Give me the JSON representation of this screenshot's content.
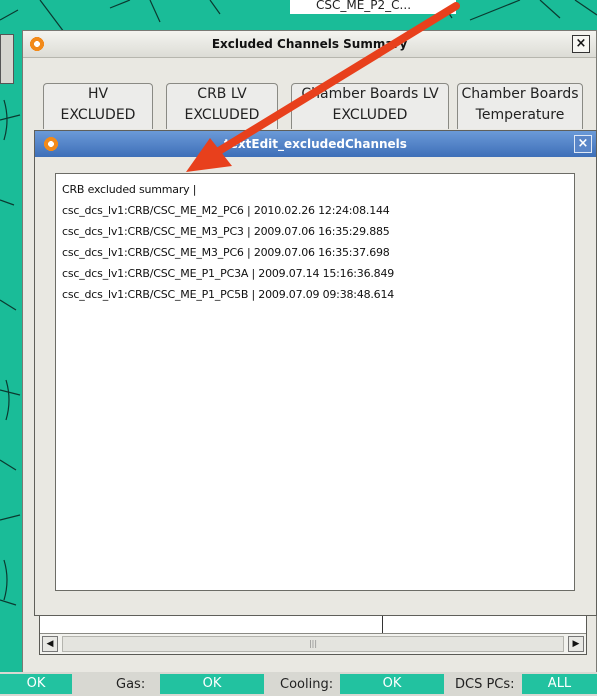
{
  "background": {
    "title": "CSC_ME_P2_C..."
  },
  "outer_window": {
    "title": "Excluded Channels Summary",
    "tabs": [
      {
        "line1": "HV",
        "line2": "EXCLUDED"
      },
      {
        "line1": "CRB LV",
        "line2": "EXCLUDED"
      },
      {
        "line1": "Chamber Boards LV",
        "line2": "EXCLUDED"
      },
      {
        "line1": "Chamber Boards",
        "line2": "Temperature"
      }
    ]
  },
  "inner_window": {
    "title": "textEdit_excludedChannels",
    "lines": [
      "CRB excluded summary |",
      "csc_dcs_lv1:CRB/CSC_ME_M2_PC6 | 2010.02.26 12:24:08.144",
      "csc_dcs_lv1:CRB/CSC_ME_M3_PC3 | 2009.07.06 16:35:29.885",
      "csc_dcs_lv1:CRB/CSC_ME_M3_PC6 | 2009.07.06 16:35:37.698",
      "csc_dcs_lv1:CRB/CSC_ME_P1_PC3A | 2009.07.14 15:16:36.849",
      "csc_dcs_lv1:CRB/CSC_ME_P1_PC5B | 2009.07.09 09:38:48.614"
    ]
  },
  "status_bar": {
    "first_value": "OK",
    "gas_label": "Gas:",
    "gas_value": "OK",
    "cooling_label": "Cooling:",
    "cooling_value": "OK",
    "dcs_label": "DCS PCs:",
    "dcs_value": "ALL"
  },
  "colors": {
    "accent_teal": "#1abc98",
    "titlebar_blue": "#4a7cc4",
    "annotation_arrow": "#e8401c"
  }
}
